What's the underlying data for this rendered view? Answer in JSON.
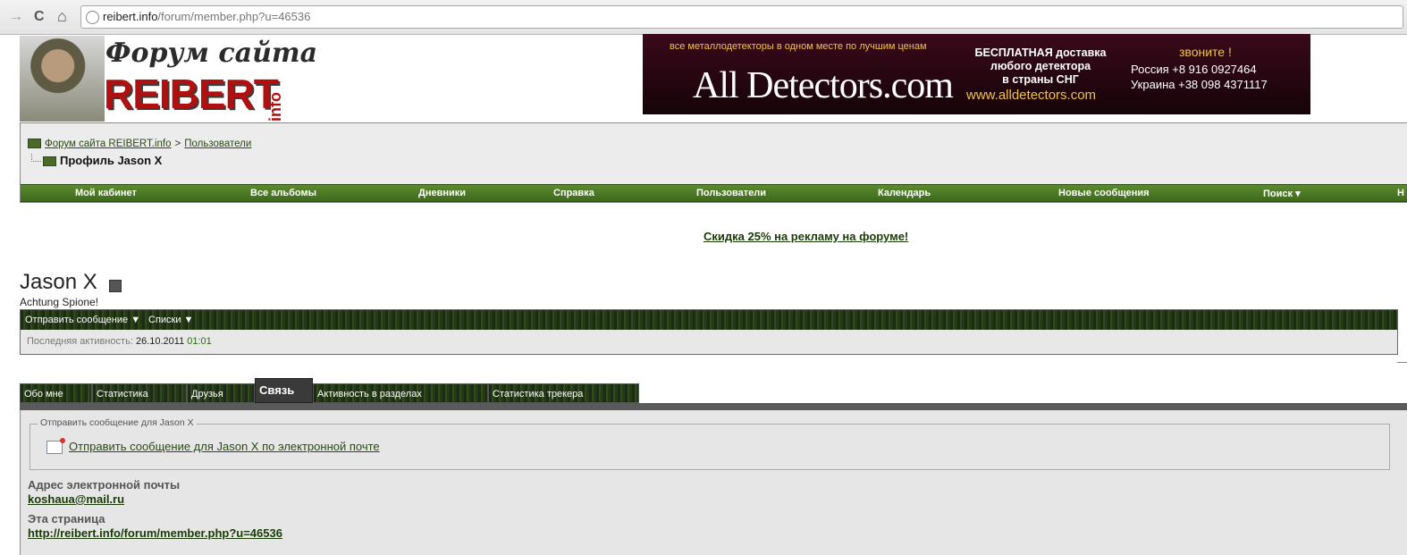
{
  "browser": {
    "url_host": "reibert.info",
    "url_path": "/forum/member.php?u=46536",
    "back_glyph": "→",
    "refresh_glyph": "C",
    "home_glyph": "⌂"
  },
  "logo": {
    "title": "Форум сайта",
    "brand": "REIBERT",
    "suffix": "info"
  },
  "banner": {
    "tagline": "все металлодетекторы в одном месте по лучшим ценам",
    "name": "All Detectors.com",
    "delivery_1": "БЕСПЛАТНАЯ доставка",
    "delivery_2": "любого детектора",
    "delivery_3": "в страны СНГ",
    "site": "www.alldetectors.com",
    "call": "звоните !",
    "phone_ru": "Россия     +8 916 0927464",
    "phone_ua": "Украина +38 098 4371117"
  },
  "breadcrumb": {
    "root": "Форум сайта REIBERT.info",
    "sep": ">",
    "section": "Пользователи",
    "current": "Профиль Jason X"
  },
  "navbar": {
    "items": [
      "Мой кабинет",
      "Все альбомы",
      "Дневники",
      "Справка",
      "Пользователи",
      "Календарь",
      "Новые сообщения",
      "Поиск ▾",
      "Н"
    ]
  },
  "promo": "Скидка 25% на рекламу на форуме!",
  "profile": {
    "username": "Jason X",
    "usertitle": "Achtung Spione!",
    "actions": [
      "Отправить сообщение ▼",
      "Списки ▼"
    ],
    "last_activity_label": "Последняя активность:",
    "last_activity_date": "26.10.2011",
    "last_activity_time": "01:01"
  },
  "tabs": [
    "Обо мне",
    "Статистика",
    "Друзья",
    "Связь",
    "Активность в разделах",
    "Статистика трекера"
  ],
  "contact": {
    "legend": "Отправить сообщение для Jason X",
    "email_link": "Отправить сообщение для Jason X по электронной почте",
    "email_label": "Адрес электронной почты",
    "email_value": "koshaua@mail.ru",
    "page_label": "Эта страница",
    "page_value": "http://reibert.info/forum/member.php?u=46536"
  }
}
